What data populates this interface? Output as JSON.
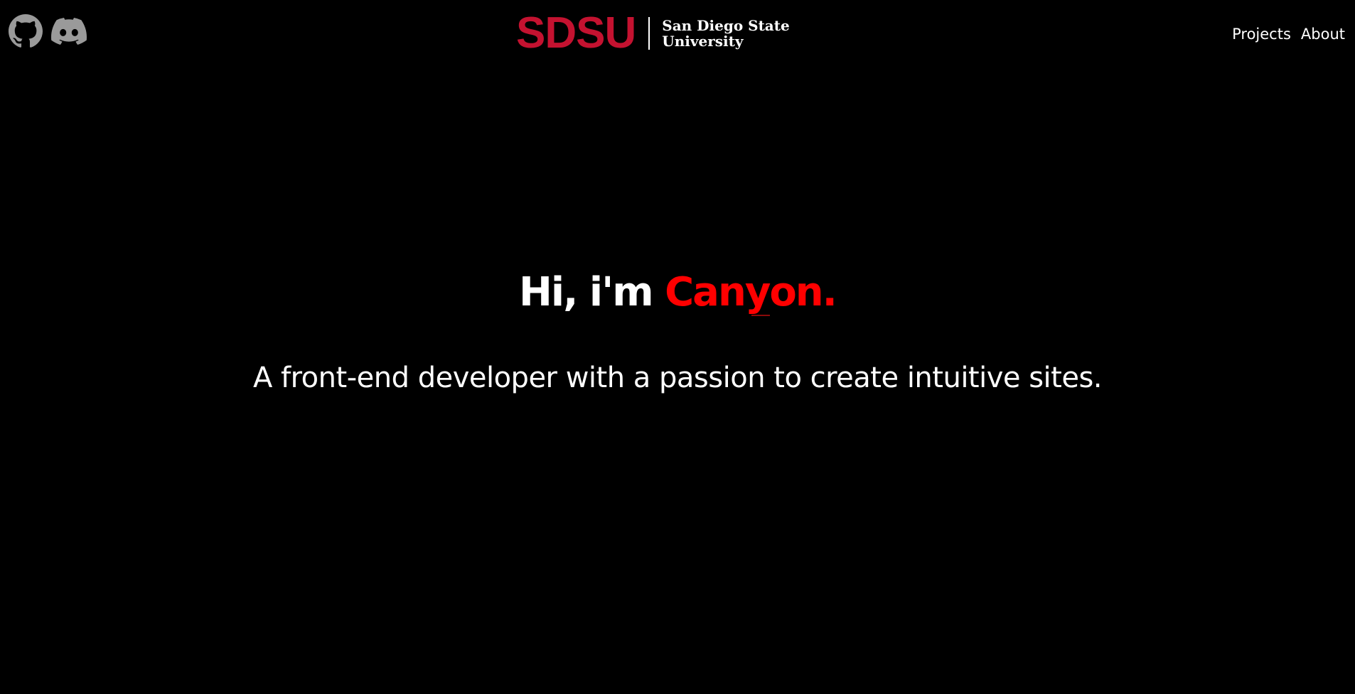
{
  "header": {
    "social": [
      {
        "name": "github",
        "icon": "github-icon"
      },
      {
        "name": "discord",
        "icon": "discord-icon"
      }
    ],
    "logo": {
      "mark": "SDSU",
      "line1": "San Diego State",
      "line2": "University",
      "brand_color": "#c41230"
    },
    "nav": {
      "projects": "Projects",
      "about": "About"
    }
  },
  "hero": {
    "title_prefix": "Hi, i'm ",
    "title_name": "Canyon.",
    "subtitle": "A front-end developer with a passion to create intuitive sites.",
    "accent_color": "#ff0000"
  },
  "theme": {
    "background": "#000000",
    "text": "#ffffff",
    "icon": "#9a9a9a"
  }
}
